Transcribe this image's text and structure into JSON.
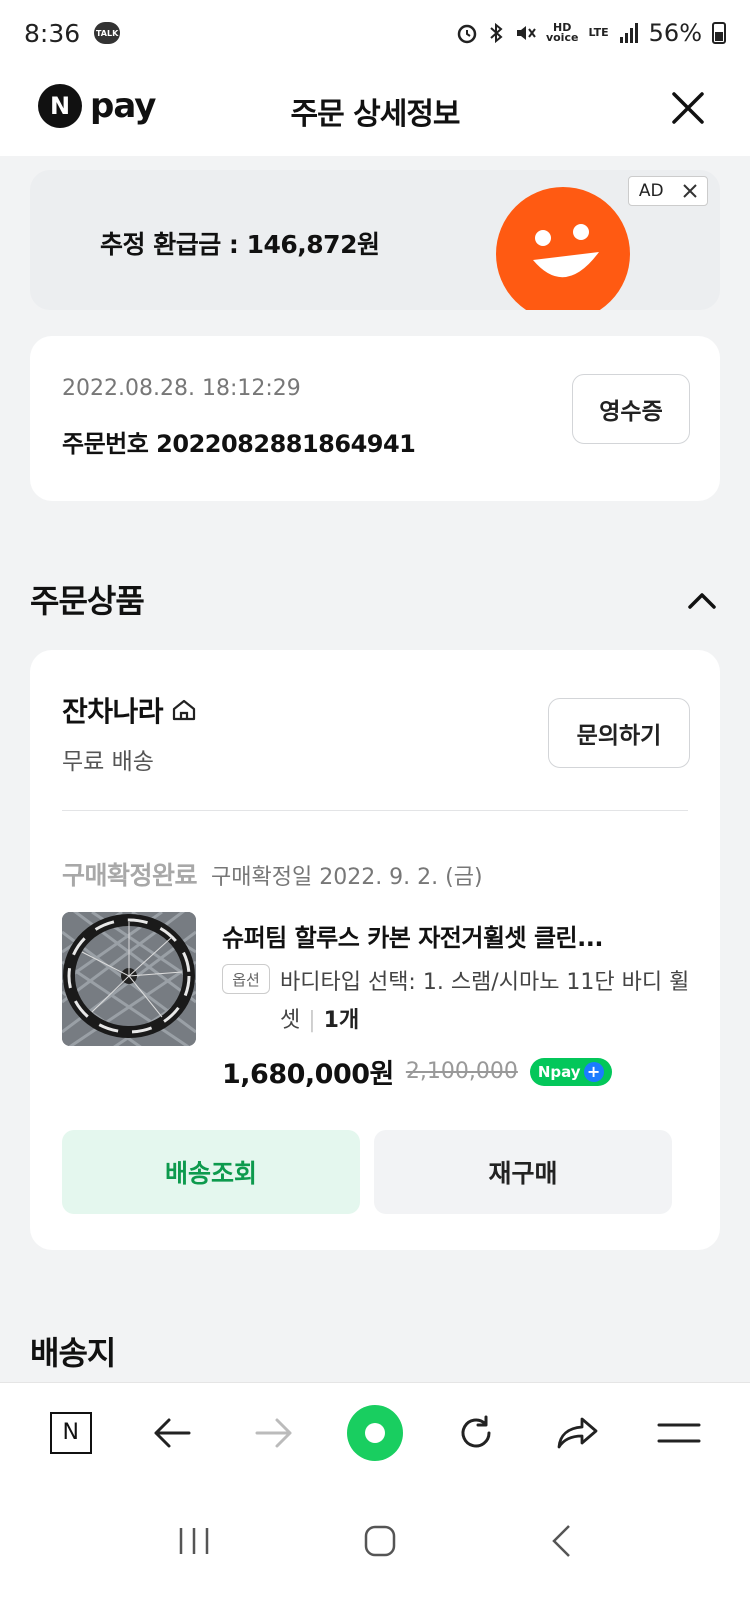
{
  "status_bar": {
    "time": "8:36",
    "talk_badge": "TALK",
    "hd_label": "HD\nvoice",
    "lte_label": "LTE",
    "battery": "56%"
  },
  "header": {
    "logo_n": "N",
    "logo_text": "pay",
    "title": "주문 상세정보"
  },
  "ad": {
    "text": "추정 환급금 : 146,872원",
    "label": "AD"
  },
  "order": {
    "datetime": "2022.08.28. 18:12:29",
    "order_number": "주문번호 2022082881864941",
    "receipt_button": "영수증"
  },
  "products_section": {
    "title": "주문상품"
  },
  "store": {
    "name": "잔차나라",
    "shipping": "무료 배송",
    "inquiry_button": "문의하기"
  },
  "item": {
    "status": "구매확정완료",
    "confirm_date": "구매확정일 2022. 9. 2. (금)",
    "name": "슈퍼팀 할루스 카본 자전거휠셋 클린...",
    "option_tag": "옵션",
    "option_text": "바디타입 선택: 1. 스램/시마노 11단 바디 휠셋",
    "quantity": "1개",
    "price": "1,680,000원",
    "original_price": "2,100,000",
    "npay_badge": "Npay"
  },
  "actions": {
    "track_button": "배송조회",
    "rebuy_button": "재구매"
  },
  "address_section": {
    "title": "배송지"
  },
  "browser_bar": {
    "home_label": "N"
  },
  "colors": {
    "brand_green": "#03c75a",
    "track_text": "#0d9a4d",
    "ad_orange": "#ff5a12"
  }
}
